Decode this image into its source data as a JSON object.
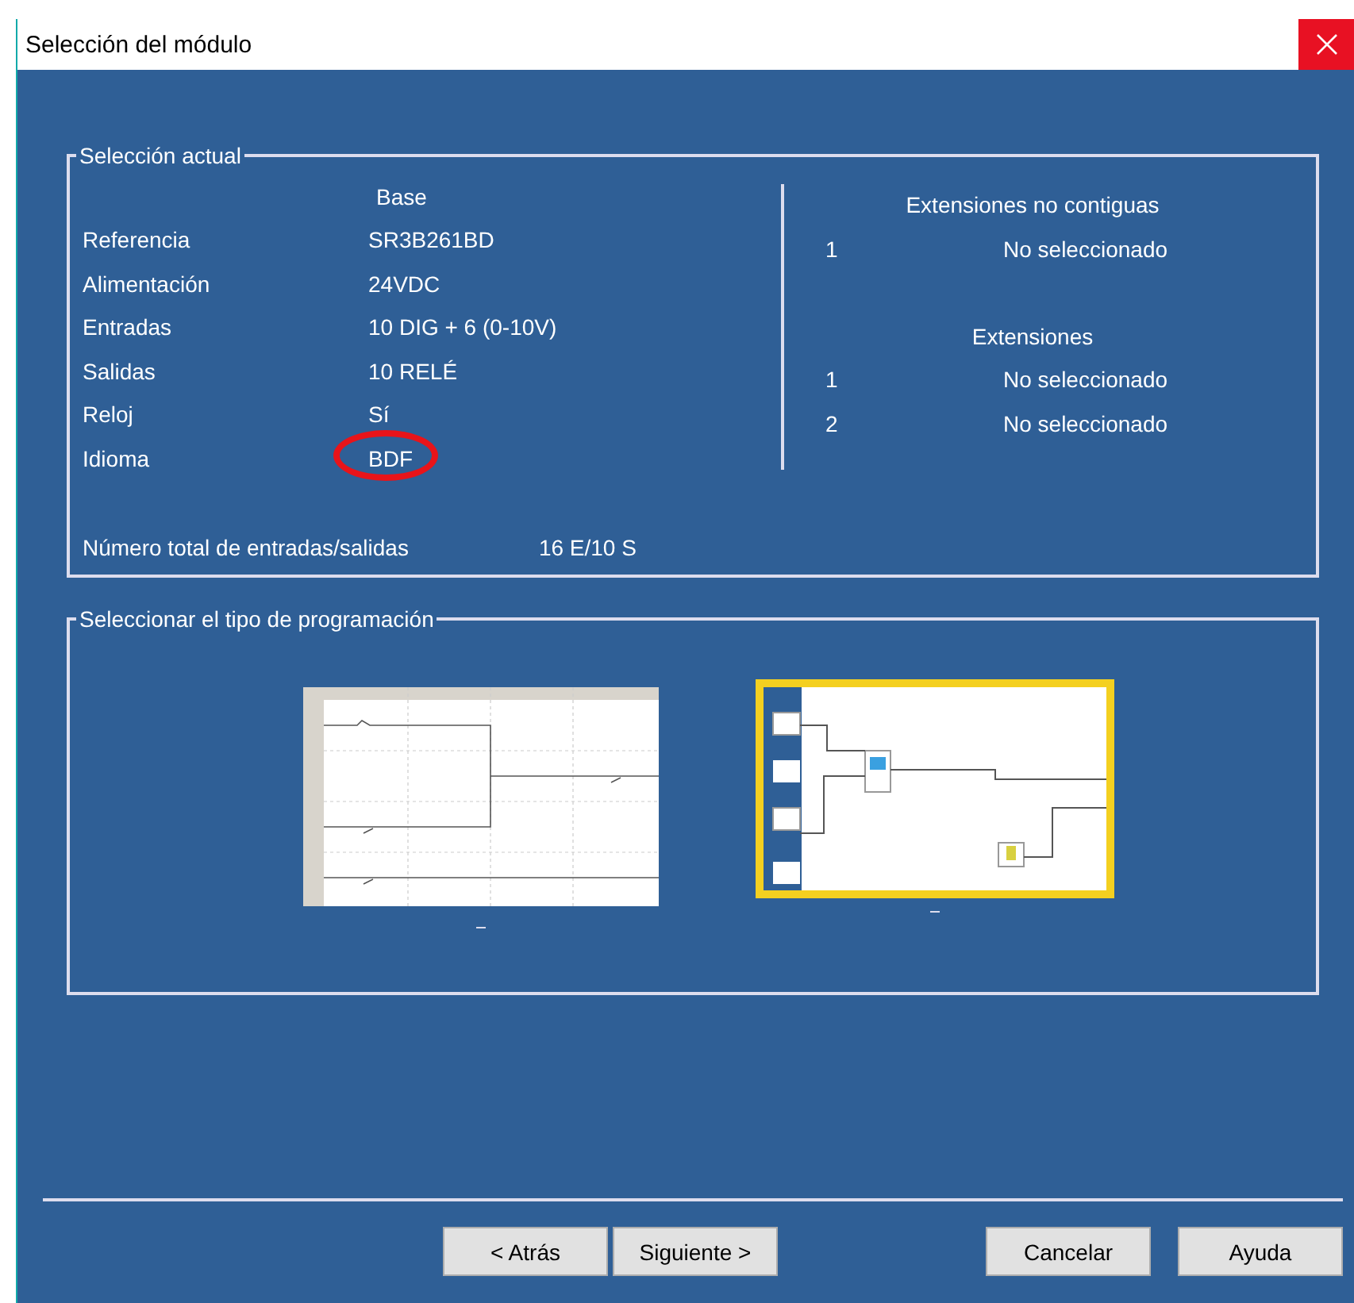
{
  "window": {
    "title": "Selección del módulo"
  },
  "current_selection": {
    "title": "Selección actual",
    "base_heading": "Base",
    "fields": [
      {
        "label": "Referencia",
        "value": "SR3B261BD",
        "circled": false
      },
      {
        "label": "Alimentación",
        "value": "24VDC",
        "circled": false
      },
      {
        "label": "Entradas",
        "value": "10 DIG + 6 (0-10V)",
        "circled": false
      },
      {
        "label": "Salidas",
        "value": "10 RELÉ",
        "circled": false
      },
      {
        "label": "Reloj",
        "value": "Sí",
        "circled": false
      },
      {
        "label": "Idioma",
        "value": "BDF",
        "circled": true
      }
    ],
    "total_label": "Número total de entradas/salidas",
    "total_value": "16 E/10 S",
    "noncontiguous_heading": "Extensiones no contiguas",
    "noncontiguous": [
      {
        "number": "1",
        "value": "No seleccionado"
      }
    ],
    "extensions_heading": "Extensiones",
    "extensions": [
      {
        "number": "1",
        "value": "No seleccionado"
      },
      {
        "number": "2",
        "value": "No seleccionado"
      }
    ]
  },
  "programming": {
    "title": "Seleccionar el tipo de programación",
    "options": [
      {
        "kind": "ladder",
        "selected": false
      },
      {
        "kind": "fbd",
        "selected": true
      }
    ]
  },
  "nav_buttons": [
    "< Atrás",
    "Siguiente >"
  ],
  "end_buttons": [
    "Cancelar",
    "Ayuda"
  ]
}
